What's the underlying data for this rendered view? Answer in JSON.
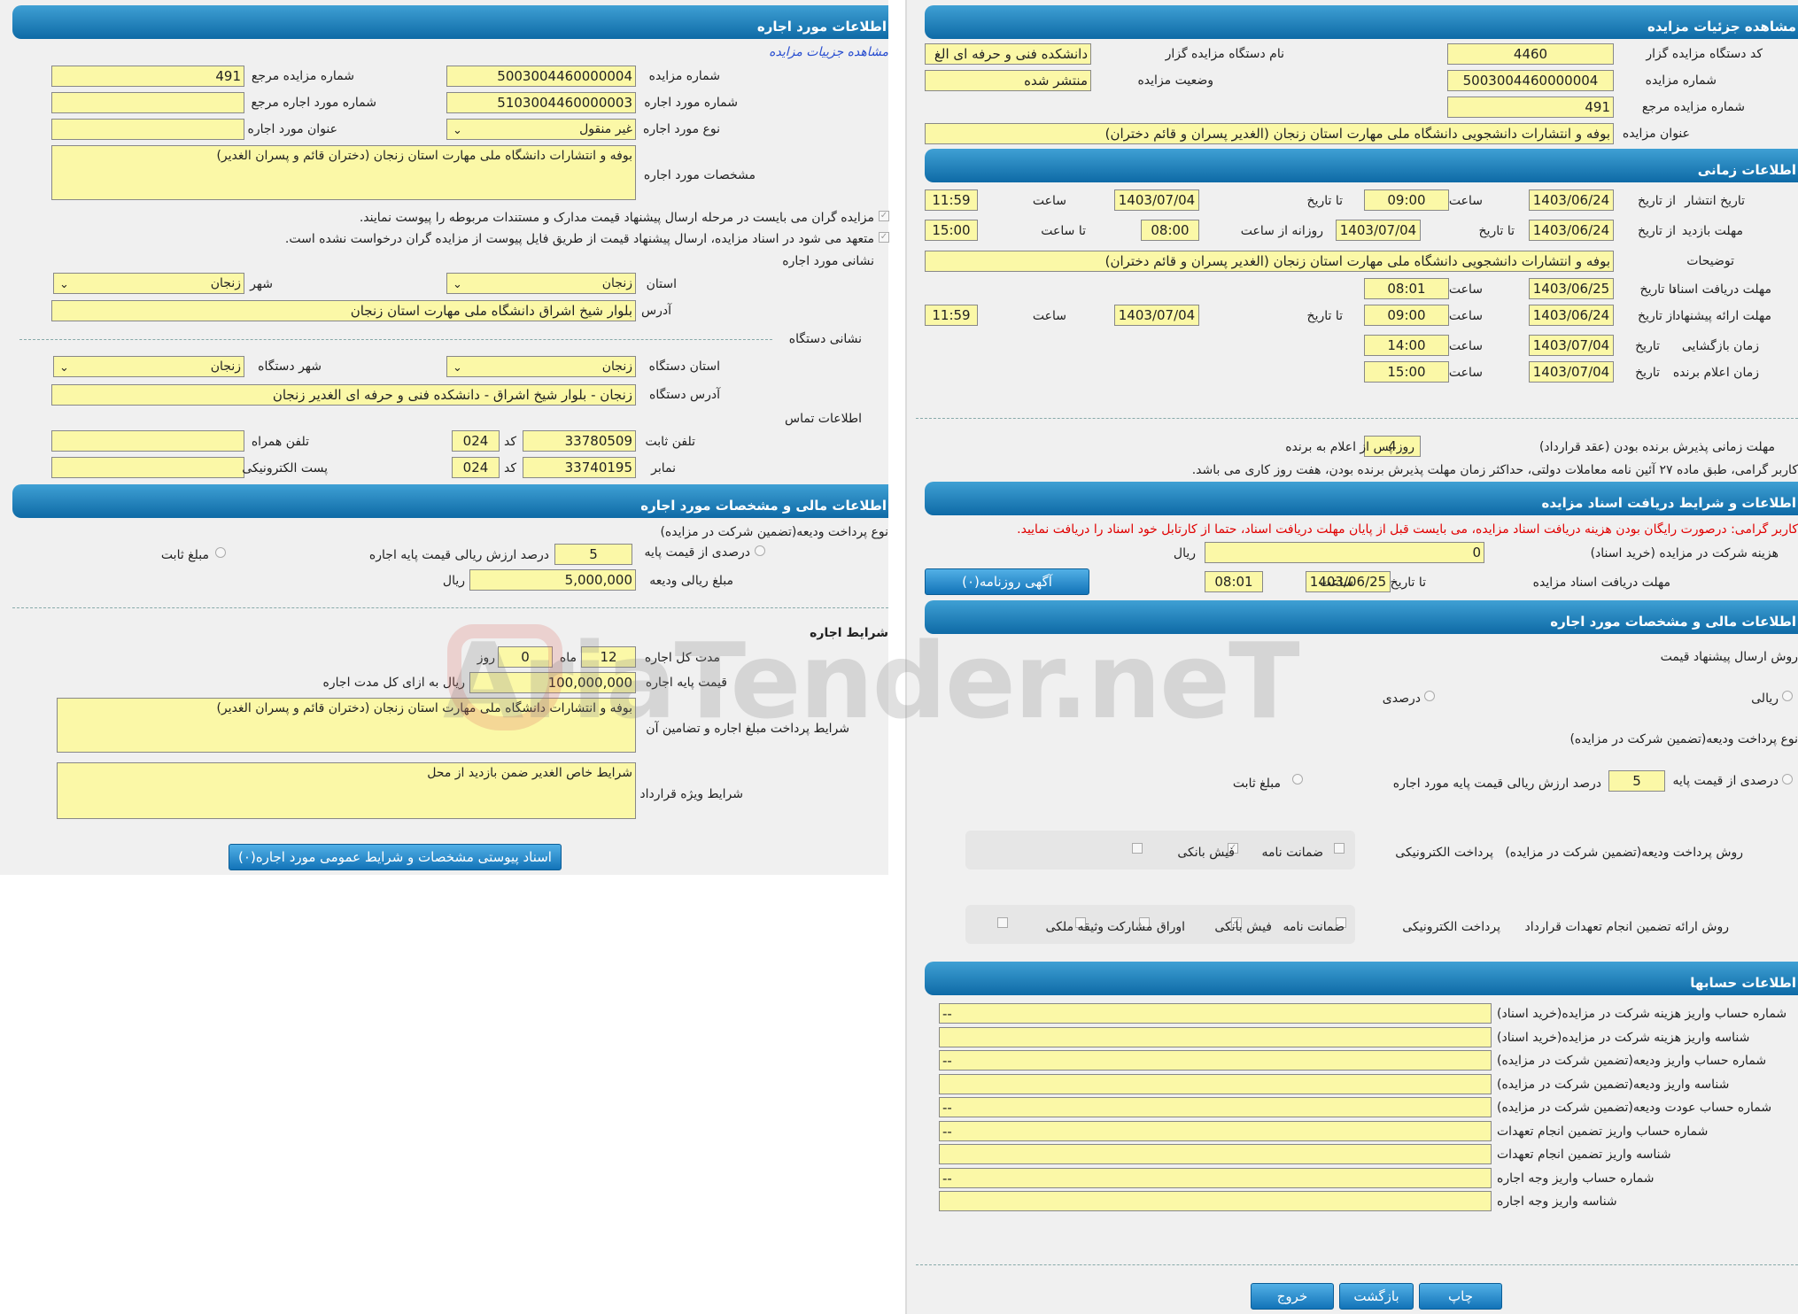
{
  "left": {
    "header1": "اطلاعات مورد اجاره",
    "link": "مشاهده جزییات مزایده",
    "auction_no_label": "شماره مزایده",
    "auction_no": "5003004460000004",
    "ref_auction_label": "شماره مزایده مرجع",
    "ref_auction": "491",
    "lease_no_label": "شماره مورد اجاره",
    "lease_no": "5103004460000003",
    "ref_lease_label": "شماره مورد اجاره مرجع",
    "ref_lease": "",
    "lease_type_label": "نوع مورد اجاره",
    "lease_type": "غیر منقول",
    "lease_title_label": "عنوان مورد اجاره",
    "lease_title": "",
    "spec_label": "مشخصات مورد اجاره",
    "spec": "بوفه و انتشارات دانشگاه ملی مهارت استان زنجان (دختران قائم و پسران الغدیر)",
    "check1": "مزایده گران می بایست در مرحله ارسال پیشنهاد قیمت مدارک و مستندات مربوطه را پیوست نمایند.",
    "check2": "متعهد می شود در اسناد مزایده، ارسال پیشنهاد قیمت از طریق فایل پیوست از مزایده گران درخواست نشده است.",
    "address_section": "نشانی مورد اجاره",
    "province_label": "استان",
    "province": "زنجان",
    "city_label": "شهر",
    "city": "زنجان",
    "address_label": "آدرس",
    "address": "بلوار شیخ اشراق دانشگاه ملی مهارت استان زنجان",
    "org_section": "نشانی دستگاه",
    "org_province_label": "استان دستگاه",
    "org_province": "زنجان",
    "org_city_label": "شهر دستگاه",
    "org_city": "زنجان",
    "org_address_label": "آدرس دستگاه",
    "org_address": "زنجان - بلوار شیخ اشراق - دانشکده فنی و حرفه ای الغدیر زنجان",
    "contact_section": "اطلاعات تماس",
    "phone_label": "تلفن ثابت",
    "phone": "33780509",
    "code_label": "کد",
    "phone_code": "024",
    "mobile_label": "تلفن همراه",
    "mobile": "",
    "fax_label": "نمابر",
    "fax": "33740195",
    "fax_code": "024",
    "email_label": "پست الکترونیکی",
    "email": "",
    "header2": "اطلاعات مالی و مشخصات مورد اجاره",
    "deposit_type_label": "نوع پرداخت ودیعه(تضمین شرکت در مزایده)",
    "percent_label": "درصدی از قیمت پایه",
    "percent": "5",
    "percent_suffix": "درصد ارزش ریالی قیمت پایه اجاره",
    "fixed_label": "مبلغ ثابت",
    "deposit_amount_label": "مبلغ ریالی ودیعه",
    "deposit_amount": "5,000,000",
    "rial": "ریال",
    "lease_terms": "شرایط اجاره",
    "duration_label": "مدت کل اجاره",
    "months": "12",
    "month_label": "ماه",
    "days": "0",
    "day_label": "روز",
    "base_price_label": "قیمت پایه اجاره",
    "base_price": "100,000,000",
    "base_price_suffix": "ریال به ازای کل مدت اجاره",
    "payment_terms_label": "شرایط پرداخت مبلغ اجاره و تضامین آن",
    "payment_terms": "بوفه و انتشارات دانشگاه ملی مهارت استان زنجان (دختران قائم و پسران الغدیر)",
    "special_terms_label": "شرایط ویژه قرارداد",
    "special_terms": "شرایط خاص الغدیر ضمن بازدید از محل",
    "attach_button": "اسناد پیوستی مشخصات و شرایط عمومی مورد اجاره(۰)"
  },
  "right": {
    "header1": "مشاهده جزئیات مزایده",
    "org_code_label": "کد دستگاه مزایده گزار",
    "org_code": "4460",
    "org_name_label": "نام دستگاه مزایده گزار",
    "org_name": "دانشکده فنی و حرفه ای الغ",
    "auction_no_label": "شماره مزایده",
    "auction_no": "5003004460000004",
    "status_label": "وضعیت مزایده",
    "status": "منتشر شده",
    "ref_no_label": "شماره مزایده مرجع",
    "ref_no": "491",
    "title_label": "عنوان مزایده",
    "title": "بوفه و انتشارات دانشجویی دانشگاه ملی مهارت استان زنجان (الغدیر پسران و قائم دختران)",
    "header2": "اطلاعات زمانی",
    "publish_label": "تاریخ انتشار",
    "from_date": "از تاریخ",
    "to_date": "تا تاریخ",
    "time": "ساعت",
    "to_time": "تا ساعت",
    "publish_from": "1403/06/24",
    "publish_from_time": "09:00",
    "publish_to": "1403/07/04",
    "publish_to_time": "11:59",
    "visit_label": "مهلت بازدید",
    "visit_from": "1403/06/24",
    "visit_to": "1403/07/04",
    "daily_from": "روزانه از ساعت",
    "visit_time_from": "08:00",
    "visit_time_to": "15:00",
    "desc_label": "توضیحات",
    "desc": "بوفه و انتشارات دانشجویی دانشگاه ملی مهارت استان زنجان (الغدیر پسران و قائم دختران)",
    "docs_deadline_label": "مهلت دریافت اسناد",
    "docs_deadline": "1403/06/25",
    "docs_deadline_time": "08:01",
    "offer_label": "مهلت ارائه پیشنهاد",
    "offer_from": "1403/06/24",
    "offer_from_time": "09:00",
    "offer_to": "1403/07/04",
    "offer_to_time": "11:59",
    "opening_label": "زمان بازگشایی",
    "date": "تاریخ",
    "opening_date": "1403/07/04",
    "opening_time": "14:00",
    "winner_label": "زمان اعلام برنده",
    "winner_date": "1403/07/04",
    "winner_time": "15:00",
    "accept_label": "مهلت زمانی پذیرش برنده بودن (عقد قرارداد)",
    "accept_days": "4",
    "accept_suffix": "روز پس از اعلام به برنده",
    "note1": "کاربر گرامی، طبق ماده ۲۷ آئین نامه معاملات دولتی، حداکثر زمان مهلت پذیرش برنده بودن، هفت روز کاری می باشد.",
    "header3": "اطلاعات و شرایط دریافت اسناد مزایده",
    "note2": "کاربر گرامی: درصورت رایگان بودن هزینه دریافت اسناد مزایده، می بایست قبل از پایان مهلت دریافت اسناد، حتما از کارتابل خود اسناد را دریافت نمایید.",
    "fee_label": "هزینه شرکت در مزایده (خرید اسناد)",
    "fee": "0",
    "rial": "ریال",
    "docs_deadline2_label": "مهلت دریافت اسناد مزایده",
    "docs_deadline2": "1403/06/25",
    "docs_deadline2_time": "08:01",
    "news_button": "آگهی روزنامه(۰)",
    "header4": "اطلاعات مالی و مشخصات مورد اجاره",
    "price_method_label": "روش ارسال پیشنهاد قیمت",
    "rial_opt": "ریالی",
    "percent_opt": "درصدی",
    "deposit_type_label": "نوع پرداخت ودیعه(تضمین شرکت در مزایده)",
    "percent_label": "درصدی از قیمت پایه",
    "percent": "5",
    "percent_suffix": "درصد ارزش ریالی قیمت پایه مورد اجاره",
    "fixed_label": "مبلغ ثابت",
    "deposit_method_label": "روش پرداخت ودیعه(تضمین شرکت در مزایده)",
    "opt_electronic": "پرداخت الکترونیکی",
    "opt_guarantee": "ضمانت نامه",
    "opt_receipt": "فیش بانکی",
    "commit_label": "روش ارائه تضمین انجام تعهدات قرارداد",
    "opt_bonds": "اوراق مشارکت",
    "opt_property": "وثیقه ملکی",
    "header5": "اطلاعات حسابها",
    "accounts": [
      {
        "label": "شماره حساب واریز هزینه شرکت در مزایده(خرید اسناد)",
        "value": "--"
      },
      {
        "label": "شناسه واریز هزینه شرکت در مزایده(خرید اسناد)",
        "value": ""
      },
      {
        "label": "شماره حساب واریز ودیعه(تضمین شرکت در مزایده)",
        "value": "--"
      },
      {
        "label": "شناسه واریز ودیعه(تضمین شرکت در مزایده)",
        "value": ""
      },
      {
        "label": "شماره حساب عودت ودیعه(تضمین شرکت در مزایده)",
        "value": "--"
      },
      {
        "label": "شماره حساب واریز تضمین انجام تعهدات",
        "value": "--"
      },
      {
        "label": "شناسه واریز تضمین انجام تعهدات",
        "value": ""
      },
      {
        "label": "شماره حساب واریز وجه اجاره",
        "value": "--"
      },
      {
        "label": "شناسه واریز وجه اجاره",
        "value": ""
      }
    ],
    "print_button": "چاپ",
    "back_button": "بازگشت",
    "exit_button": "خروج"
  },
  "watermark": "AriaTender.neT"
}
